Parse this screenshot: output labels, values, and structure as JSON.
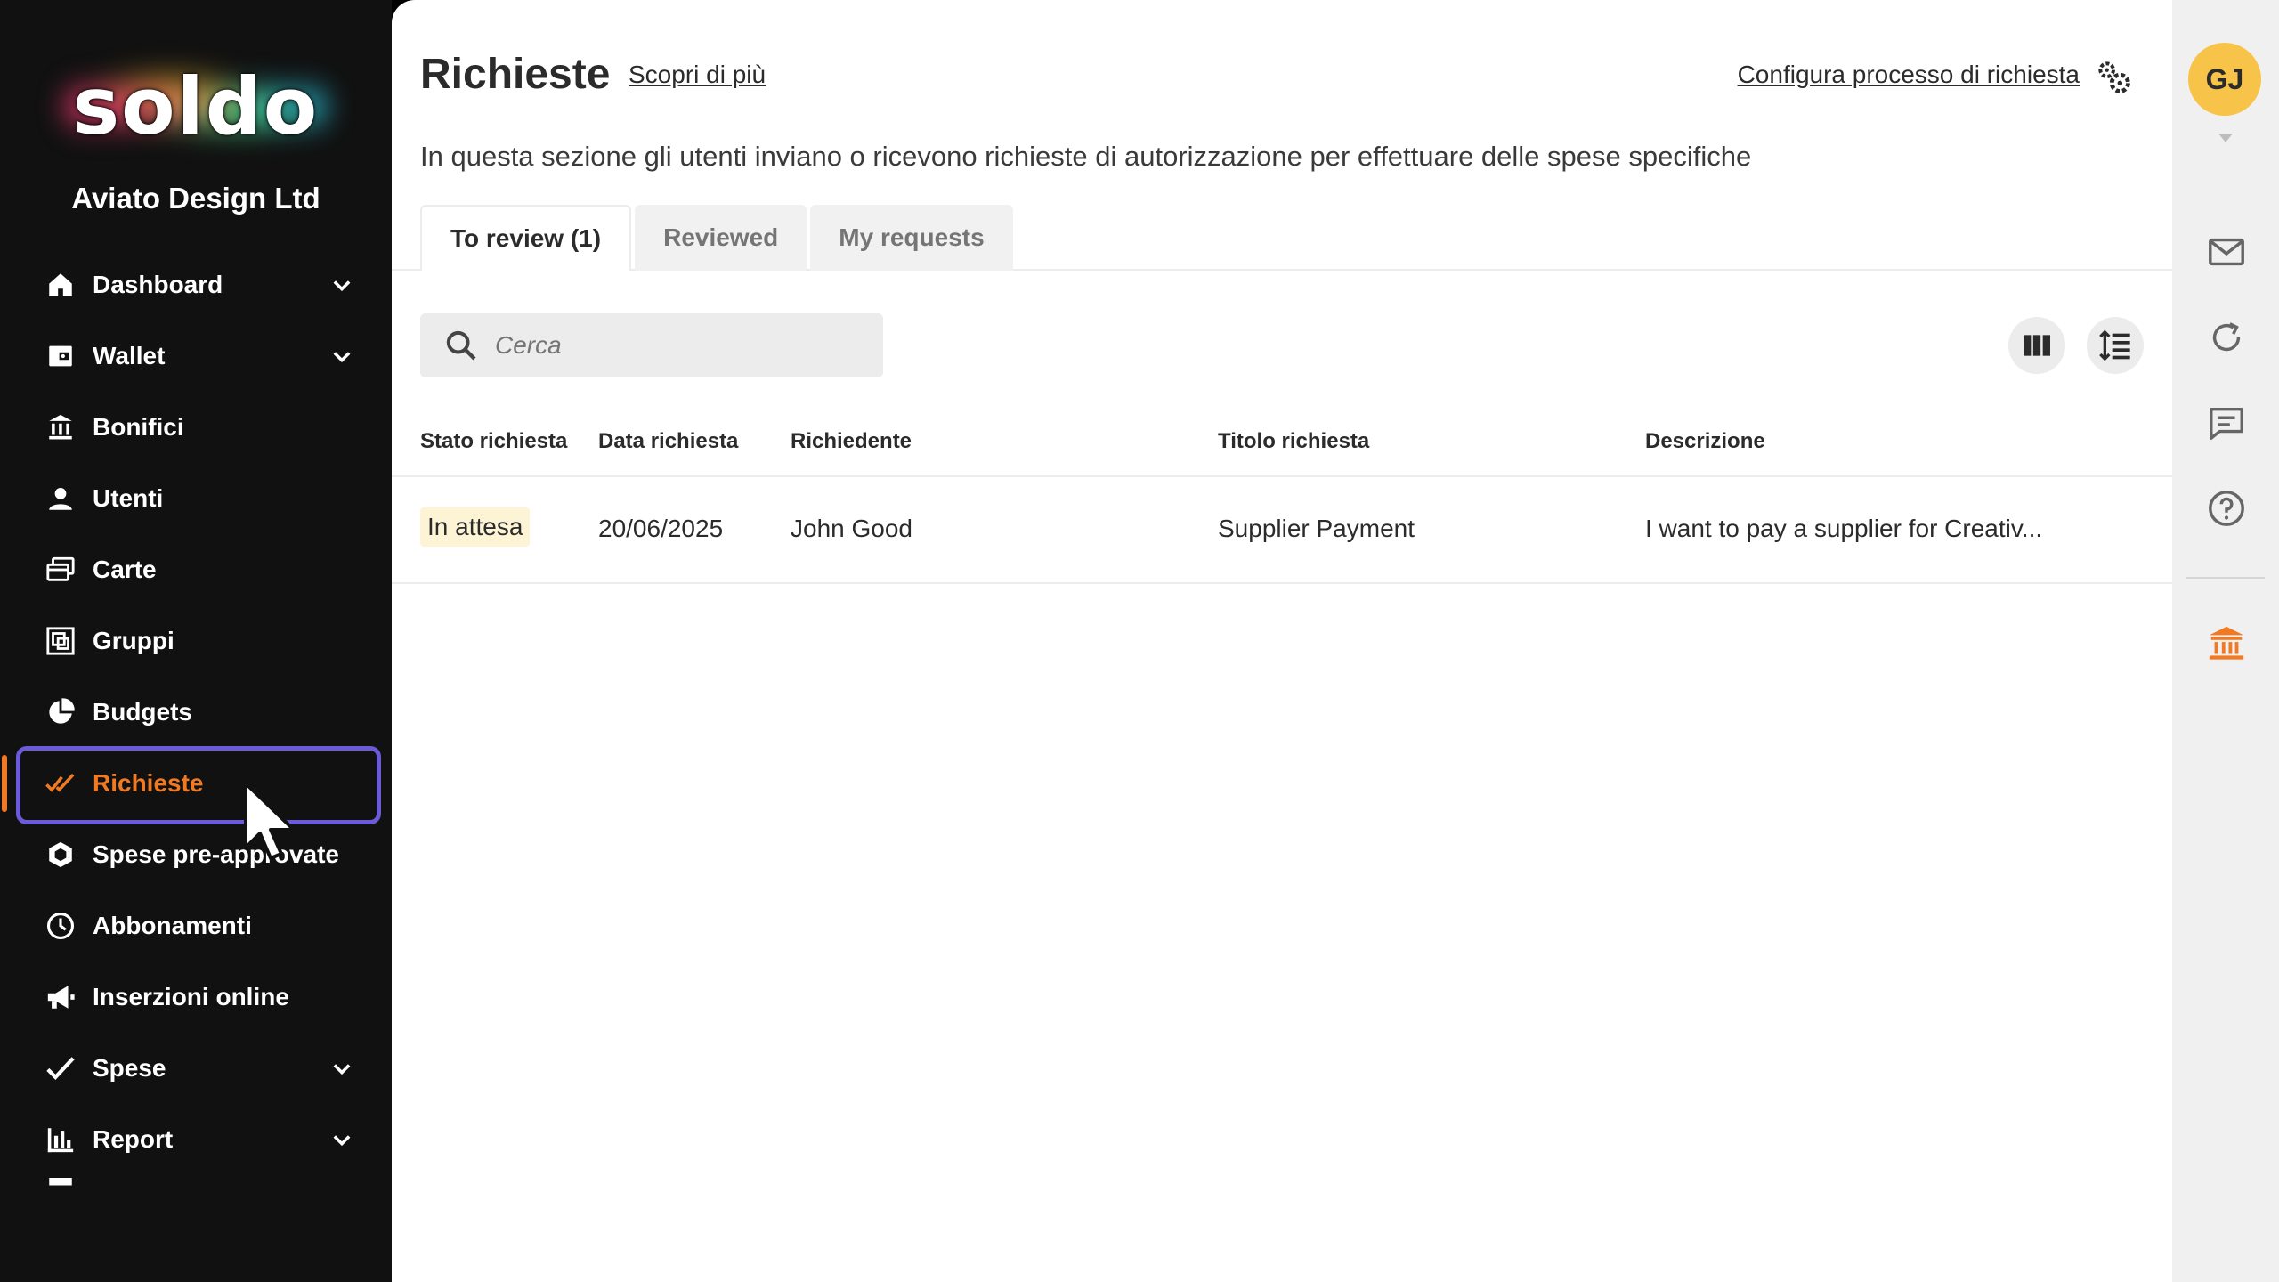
{
  "brand": {
    "logo_text": "soldo",
    "company": "Aviato Design Ltd"
  },
  "sidebar": {
    "items": [
      {
        "label": "Dashboard",
        "icon": "home-icon",
        "expandable": true
      },
      {
        "label": "Wallet",
        "icon": "wallet-icon",
        "expandable": true
      },
      {
        "label": "Bonifici",
        "icon": "bank-transfer-icon",
        "expandable": false
      },
      {
        "label": "Utenti",
        "icon": "user-icon",
        "expandable": false
      },
      {
        "label": "Carte",
        "icon": "cards-icon",
        "expandable": false
      },
      {
        "label": "Gruppi",
        "icon": "groups-icon",
        "expandable": false
      },
      {
        "label": "Budgets",
        "icon": "pie-chart-icon",
        "expandable": false
      },
      {
        "label": "Richieste",
        "icon": "double-check-icon",
        "expandable": false,
        "active": true
      },
      {
        "label": "Spese pre-approvate",
        "icon": "hexagon-icon",
        "expandable": false
      },
      {
        "label": "Abbonamenti",
        "icon": "clock-icon",
        "expandable": false
      },
      {
        "label": "Inserzioni online",
        "icon": "megaphone-icon",
        "expandable": false
      },
      {
        "label": "Spese",
        "icon": "check-icon",
        "expandable": true
      },
      {
        "label": "Report",
        "icon": "bar-chart-icon",
        "expandable": true
      }
    ]
  },
  "header": {
    "title": "Richieste",
    "learn_more": "Scopri di più",
    "configure": "Configura processo di richiesta",
    "subtitle": "In questa sezione gli utenti inviano o ricevono richieste di autorizzazione per effettuare delle spese specifiche"
  },
  "tabs": [
    {
      "label": "To review (1)",
      "active": true
    },
    {
      "label": "Reviewed",
      "active": false
    },
    {
      "label": "My requests",
      "active": false
    }
  ],
  "search": {
    "placeholder": "Cerca"
  },
  "table": {
    "columns": [
      "Stato richiesta",
      "Data richiesta",
      "Richiedente",
      "Titolo richiesta",
      "Descrizione"
    ],
    "rows": [
      {
        "status": "In attesa",
        "date": "20/06/2025",
        "requester": "John Good",
        "title": "Supplier Payment",
        "description": "I want to pay a supplier for Creativ..."
      }
    ]
  },
  "user": {
    "initials": "GJ"
  },
  "colors": {
    "accent": "#f07a24",
    "highlight": "#6b5bd6",
    "sidebar_bg": "#111111",
    "avatar": "#f7c348",
    "status_pending": "#fdf4d6"
  }
}
